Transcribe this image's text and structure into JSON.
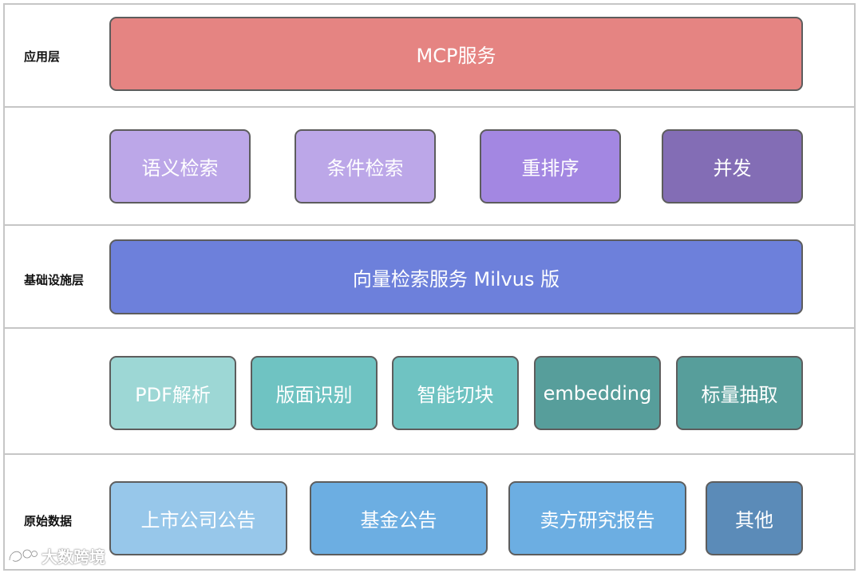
{
  "layers": {
    "application": {
      "label": "应用层"
    },
    "infrastructure": {
      "label": "基础设施层"
    },
    "raw_data": {
      "label": "原始数据"
    }
  },
  "boxes": {
    "mcp": "MCP服务",
    "semantic_search": "语义检索",
    "conditional_search": "条件检索",
    "rerank": "重排序",
    "concurrency": "并发",
    "vector_service": "向量检索服务 Milvus 版",
    "pdf_parse": "PDF解析",
    "layout_recognition": "版面识别",
    "smart_chunking": "智能切块",
    "embedding": "embedding",
    "scalar_extraction": "标量抽取",
    "listed_company": "上市公司公告",
    "fund": "基金公告",
    "sell_side": "卖方研究报告",
    "other": "其他"
  },
  "watermark": {
    "text": "大数跨境",
    "icon": "logo-icon"
  },
  "colors": {
    "mcp": "#e58482",
    "light_purple": "#bca7e8",
    "mid_purple": "#a387e2",
    "dark_purple": "#836db5",
    "indigo": "#6d80db",
    "light_teal": "#9dd7d5",
    "teal": "#6fc3c2",
    "dark_teal": "#579e9b",
    "light_blue": "#97c7ea",
    "blue": "#6caee2",
    "steel_blue": "#5b8bb8",
    "border": "#5d5d5d",
    "layer_border": "#c6c6c6"
  }
}
